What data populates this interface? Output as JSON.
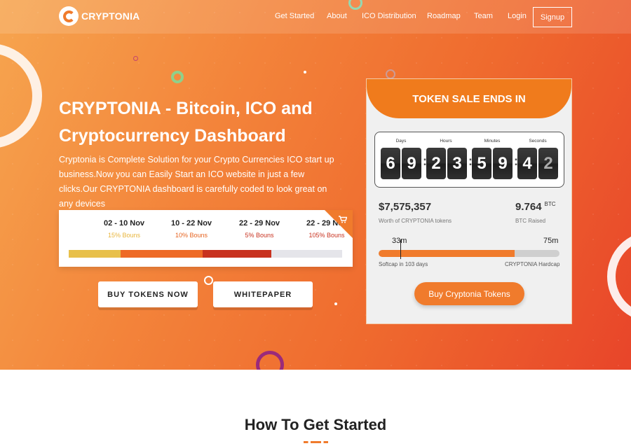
{
  "brand": {
    "name": "CRYPTONIA",
    "logo_letter": "C"
  },
  "nav": {
    "items": [
      "Get Started",
      "About",
      "ICO Distribution",
      "Roadmap",
      "Team",
      "Login"
    ],
    "signup_label": "Signup"
  },
  "hero": {
    "title": "CRYPTONIA - Bitcoin, ICO and Cryptocurrency Dashboard",
    "description": "Cryptonia is Complete Solution for your Crypto Currencies ICO start up business.Now you can Easily Start an ICO website in just a few clicks.Our CRYPTONIA dashboard is carefully coded to look great on any devices",
    "phases": [
      {
        "date": "02 - 10 Nov",
        "bonus": "15% Bouns",
        "color": "#e8c04a"
      },
      {
        "date": "10 - 22 Nov",
        "bonus": "10% Bouns",
        "color": "#ee6a26"
      },
      {
        "date": "22 - 29 Nov",
        "bonus": "5% Bouns",
        "color": "#c8321f"
      },
      {
        "date": "22 - 29 Nov",
        "bonus": "105% Bouns",
        "color": "#c8321f"
      }
    ],
    "phase_progress_segments": [
      0.19,
      0.3,
      0.25,
      0.26
    ],
    "phase_remaining_color": "#e5e5ea",
    "buy_tokens_label": "BUY TOKENS NOW",
    "whitepaper_label": "WHITEPAPER"
  },
  "token_sale": {
    "header": "TOKEN SALE ENDS IN",
    "countdown": {
      "labels": [
        "Days",
        "Hours",
        "Minutes",
        "Seconds"
      ],
      "digits": [
        "6",
        "9",
        "2",
        "3",
        "5",
        "9",
        "4",
        "2"
      ]
    },
    "worth_value": "$7,575,357",
    "worth_label": "Worth of CRYPTONIA tokens",
    "btc_value": "9.764",
    "btc_unit": "BTC",
    "btc_label": "BTC Raised",
    "softcap_value": "33m",
    "hardcap_value": "75m",
    "progress": 0.75,
    "softcap_label": "Softcap in 103 days",
    "hardcap_label": "CRYPTONIA Hardcap",
    "buy_label": "Buy Cryptonia Tokens"
  },
  "section": {
    "title": "How To Get Started"
  },
  "colors": {
    "accent": "#f07b2c",
    "hero_start": "#f6a54f",
    "hero_end": "#e8452a"
  }
}
